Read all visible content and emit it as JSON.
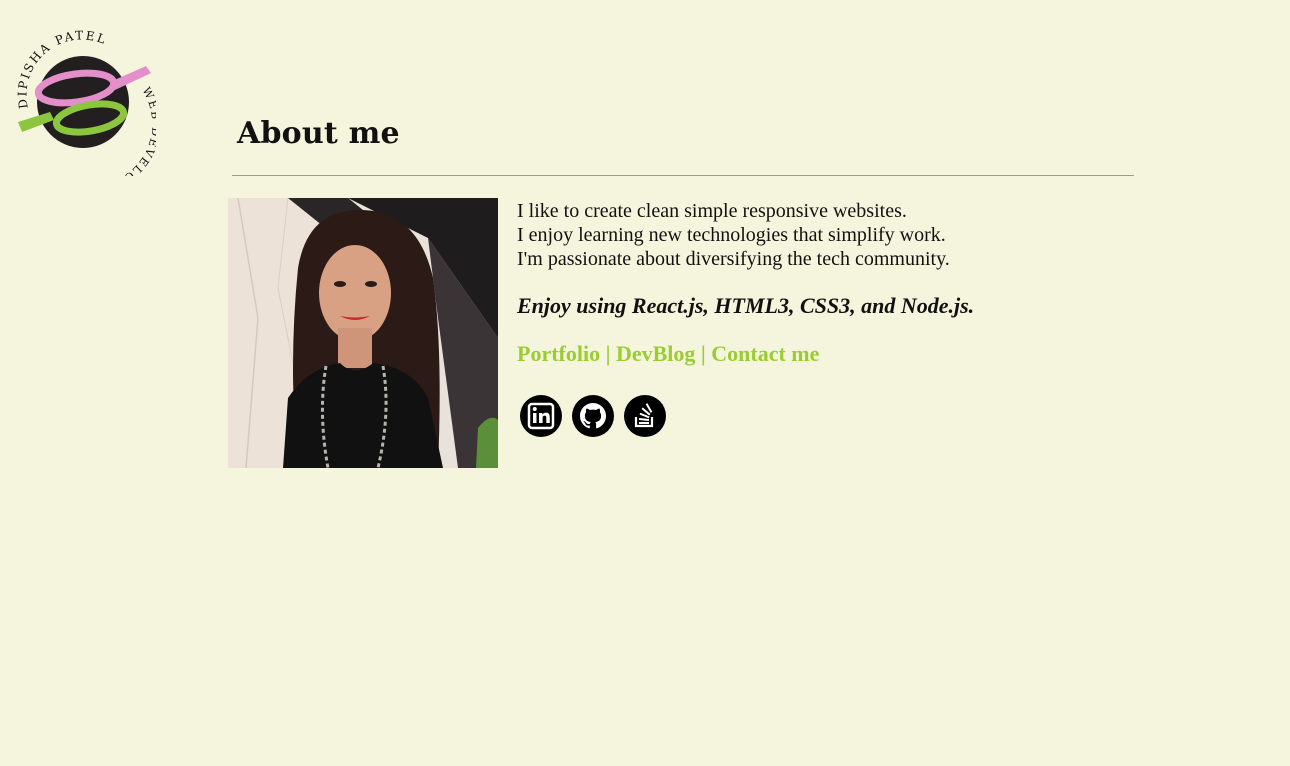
{
  "logo": {
    "name": "DIPISHA PATEL",
    "role": "WEB DEVELOPER"
  },
  "about": {
    "heading": "About me",
    "bio_lines": [
      "I like to create clean simple responsive websites.",
      "I enjoy learning new technologies that simplify work.",
      "I'm passionate about diversifying the tech community."
    ],
    "tech_line": "Enjoy using React.js, HTML3, CSS3, and Node.js."
  },
  "links": {
    "items": [
      "Portfolio",
      "DevBlog",
      "Contact me"
    ],
    "separator": " | "
  },
  "social": {
    "icons": [
      "linkedin-icon",
      "github-icon",
      "stackoverflow-icon"
    ]
  },
  "colors": {
    "background": "#f5f4dc",
    "accent_green": "#9acd32",
    "logo_pink": "#e38fc9",
    "logo_dark": "#231f20"
  }
}
